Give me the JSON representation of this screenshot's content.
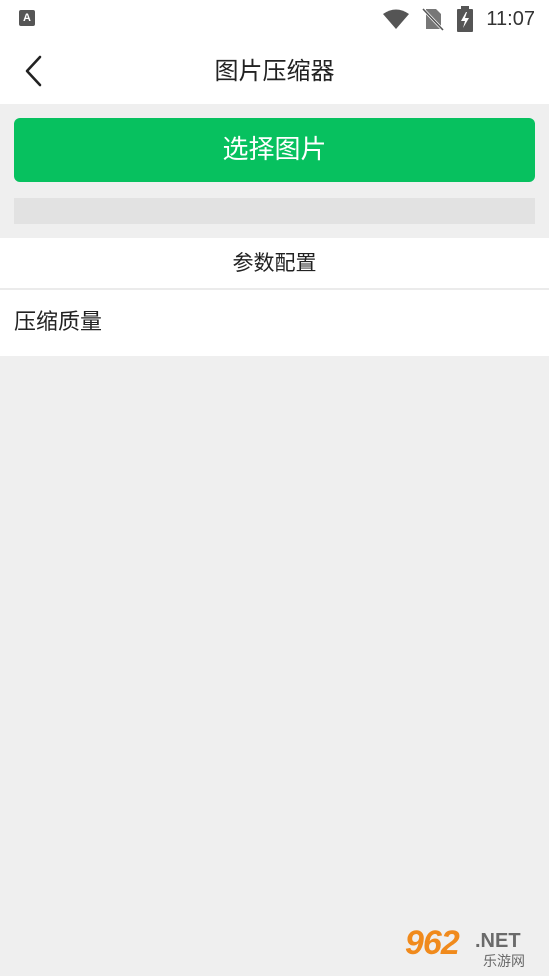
{
  "status_bar": {
    "app_icon_letter": "A",
    "time": "11:07",
    "icons": [
      "wifi-icon",
      "no-sim-icon",
      "battery-charging-icon"
    ]
  },
  "header": {
    "title": "图片压缩器",
    "back_icon": "chevron-left-icon"
  },
  "select_button": {
    "label": "选择图片"
  },
  "progress": {
    "value": 0
  },
  "config": {
    "section_title": "参数配置",
    "quality_label": "压缩质量"
  },
  "watermark": {
    "number": "962",
    "suffix": ".NET",
    "site_name": "乐游网"
  },
  "colors": {
    "accent": "#07c15f",
    "background": "#efefef"
  }
}
